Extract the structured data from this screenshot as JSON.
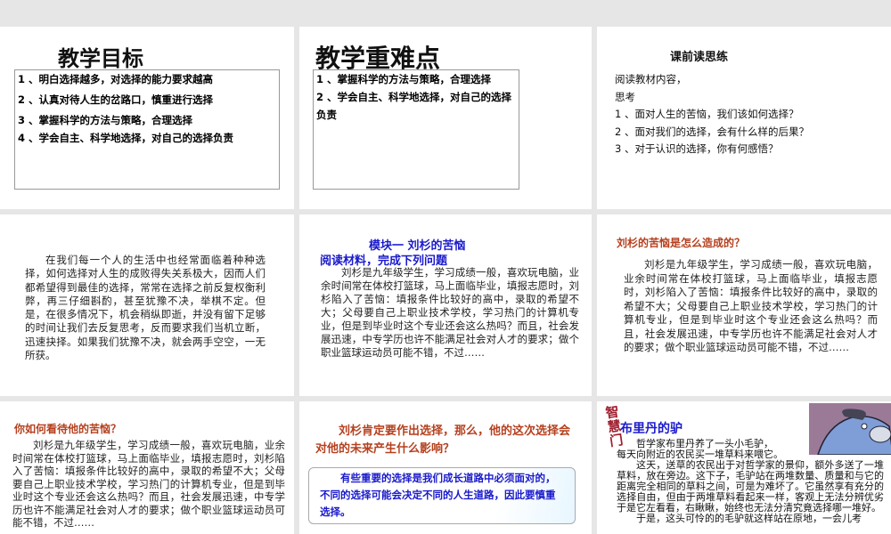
{
  "slides": [
    {
      "title": "教学目标",
      "items": [
        "1 、明白选择越多，对选择的能力要求越高",
        "2 、认真对待人生的岔路口，慎重进行选择",
        "3 、掌握科学的方法与策略，合理选择",
        "4 、学会自主、科学地选择，对自己的选择负责"
      ]
    },
    {
      "title": "教学重难点",
      "items": [
        "1 、掌握科学的方法与策略，合理选择",
        "2 、学会自主、科学地选择，对自己的选择负责"
      ]
    },
    {
      "title": "课前读思练",
      "lines": [
        "阅读教材内容，",
        "思考",
        "1 、面对人生的苦恼，我们该如何选择？",
        "2 、面对我们的选择，会有什么样的后果？",
        "3 、对于认识的选择，你有何感悟？"
      ]
    },
    {
      "text": "在我们每一个人的生活中也经常面临着种种选择，如何选择对人生的成败得失关系极大，因而人们都希望得到最佳的选择，常常在选择之前反复权衡利弊，再三仔细斟酌，甚至犹豫不决，举棋不定。但是，在很多情况下，机会稍纵即逝，并没有留下足够的时间让我们去反复思考，反而要求我们当机立断，迅速抉择。如果我们犹豫不决，就会两手空空，一无所获。"
    },
    {
      "title": "模块一  刘杉的苦恼",
      "subtitle": "阅读材料，完成下列问题",
      "text": "刘杉是九年级学生，学习成绩一般，喜欢玩电脑，业余时间常在体校打篮球，马上面临毕业，填报志愿时，刘杉陷入了苦恼：填报条件比较好的高中，录取的希望不大；父母要自己上职业技术学校，学习热门的计算机专业，但是到毕业时这个专业还会这么热吗？而且，社会发展迅速，中专学历也许不能满足社会对人才的要求；做个职业篮球运动员可能不错，不过……"
    },
    {
      "title": "刘杉的苦恼是怎么造成的？",
      "text": "刘杉是九年级学生，学习成绩一般，喜欢玩电脑，业余时间常在体校打篮球，马上面临毕业，填报志愿时，刘杉陷入了苦恼：填报条件比较好的高中，录取的希望不大；父母要自己上职业技术学校，学习热门的计算机专业，但是到毕业时这个专业还会这么热吗？而且，社会发展迅速，中专学历也许不能满足社会对人才的要求；做个职业篮球运动员可能不错，不过……"
    },
    {
      "title": "你如何看待他的苦恼？",
      "text": "刘杉是九年级学生，学习成绩一般，喜欢玩电脑，业余时间常在体校打篮球，马上面临毕业，填报志愿时，刘杉陷入了苦恼：填报条件比较好的高中，录取的希望不大；父母要自己上职业技术学校，学习热门的计算机专业，但是到毕业时这个专业还会这么热吗？而且，社会发展迅速，中专学历也许不能满足社会对人才的要求；做个职业篮球运动员可能不错，不过……"
    },
    {
      "title": "刘杉肯定要作出选择，那么，他的这次选择会对他的未来产生什么影响？",
      "scroll": "有些重要的选择是我们成长道路中必须面对的，不同的选择可能会决定不同的人生道路，因此要慎重选择。"
    },
    {
      "tag": "智慧门",
      "title": "布里丹的驴",
      "p1": "哲学家布里丹养了一头小毛驴，",
      "p2": "每天向附近的农民买一堆草料来喂它。",
      "p3": "这天，送草的农民出于对哲学家的景仰，额外多送了一堆草料，放在旁边。这下子，毛驴站在两堆数量、质量和与它的距离完全相同的草料之间，可是为难坏了。它虽然享有充分的选择自由，但由于两堆草料看起来一样，客观上无法分辨优劣于是它左看看，右瞅瞅，始终也无法分清究竟选择哪一堆好。",
      "p4": "于是，这头可怜的的毛驴就这样站在原地，一会儿考"
    }
  ]
}
